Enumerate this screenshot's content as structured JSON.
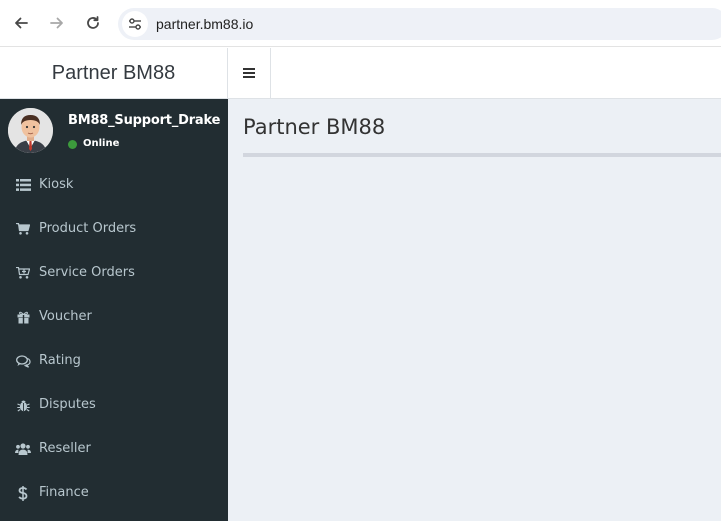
{
  "browser": {
    "url": "partner.bm88.io"
  },
  "header": {
    "brand": "Partner BM88"
  },
  "user": {
    "name": "BM88_Support_Drake",
    "status": "Online",
    "status_color": "#3c9a3c"
  },
  "sidebar": {
    "background": "#222d32",
    "items": [
      {
        "label": "Kiosk",
        "icon": "list-icon"
      },
      {
        "label": "Product Orders",
        "icon": "cart-icon"
      },
      {
        "label": "Service Orders",
        "icon": "cart-plus-icon"
      },
      {
        "label": "Voucher",
        "icon": "gift-icon"
      },
      {
        "label": "Rating",
        "icon": "comments-icon"
      },
      {
        "label": "Disputes",
        "icon": "bug-icon"
      },
      {
        "label": "Reseller",
        "icon": "users-icon"
      },
      {
        "label": "Finance",
        "icon": "dollar-icon"
      }
    ]
  },
  "main": {
    "title": "Partner BM88"
  }
}
